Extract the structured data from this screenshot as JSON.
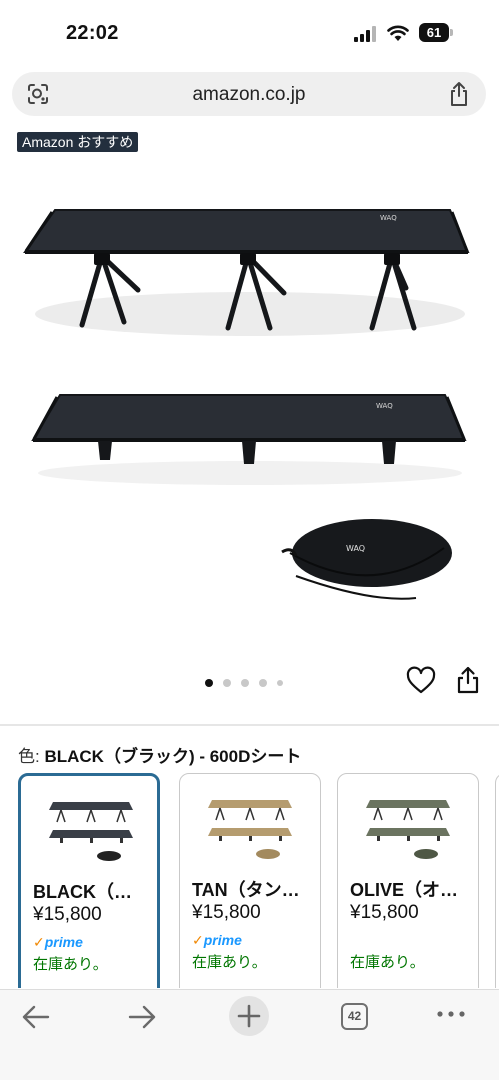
{
  "status_bar": {
    "time": "22:02",
    "battery": "61"
  },
  "browser": {
    "url": "amazon.co.jp",
    "lens_icon": "lens-icon",
    "share_icon": "share-icon"
  },
  "gallery": {
    "badge": "Amazon おすすめ",
    "brand_mark": "WAQ",
    "image_count": 5,
    "active_image": 1
  },
  "color": {
    "prefix": "色:",
    "selected": "BLACK（ブラック) - 600Dシート"
  },
  "variants": [
    {
      "name": "BLACK（…",
      "price": "¥15,800",
      "prime": "prime",
      "stock": "在庫あり。",
      "color": "#3a3f47",
      "selected": true
    },
    {
      "name": "TAN（タン…",
      "price": "¥15,800",
      "prime": "prime",
      "stock": "在庫あり。",
      "color": "#b59c6f",
      "selected": false
    },
    {
      "name": "OLIVE（オ…",
      "price": "¥15,800",
      "prime": "",
      "stock": "在庫あり。",
      "color": "#6b7460",
      "selected": false
    }
  ],
  "toolbar": {
    "tab_count": "42"
  },
  "colors": {
    "selected_border": "#2b6b94",
    "stock_green": "#007600",
    "prime_blue": "#1a98ff",
    "badge_bg": "#232f3e"
  }
}
